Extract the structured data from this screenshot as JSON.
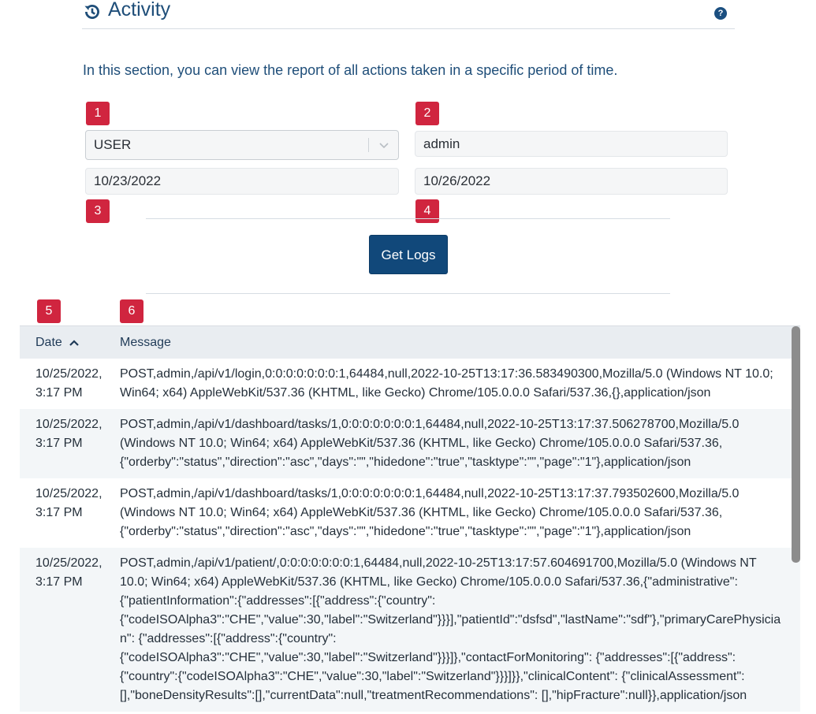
{
  "header": {
    "title": "Activity",
    "help_icon": "?"
  },
  "intro": "In this section, you can view the report of all actions taken in a specific period of time.",
  "badges": [
    "1",
    "2",
    "3",
    "4",
    "5",
    "6"
  ],
  "filters": {
    "type_value": "USER",
    "user_value": "admin",
    "from_date": "10/23/2022",
    "to_date": "10/26/2022"
  },
  "actions": {
    "get_logs": "Get Logs"
  },
  "table": {
    "columns": {
      "date": "Date",
      "message": "Message"
    },
    "rows": [
      {
        "date": "10/25/2022, 3:17 PM",
        "message": "POST,admin,/api/v1/login,0:0:0:0:0:0:0:1,64484,null,2022-10-25T13:17:36.583490300,Mozilla/5.0 (Windows NT 10.0; Win64; x64) AppleWebKit/537.36 (KHTML, like Gecko) Chrome/105.0.0.0 Safari/537.36,{},application/json"
      },
      {
        "date": "10/25/2022, 3:17 PM",
        "message": "POST,admin,/api/v1/dashboard/tasks/1,0:0:0:0:0:0:0:1,64484,null,2022-10-25T13:17:37.506278700,Mozilla/5.0 (Windows NT 10.0; Win64; x64) AppleWebKit/537.36 (KHTML, like Gecko) Chrome/105.0.0.0 Safari/537.36, {\"orderby\":\"status\",\"direction\":\"asc\",\"days\":\"\",\"hidedone\":\"true\",\"tasktype\":\"\",\"page\":\"1\"},application/json"
      },
      {
        "date": "10/25/2022, 3:17 PM",
        "message": "POST,admin,/api/v1/dashboard/tasks/1,0:0:0:0:0:0:0:1,64484,null,2022-10-25T13:17:37.793502600,Mozilla/5.0 (Windows NT 10.0; Win64; x64) AppleWebKit/537.36 (KHTML, like Gecko) Chrome/105.0.0.0 Safari/537.36, {\"orderby\":\"status\",\"direction\":\"asc\",\"days\":\"\",\"hidedone\":\"true\",\"tasktype\":\"\",\"page\":\"1\"},application/json"
      },
      {
        "date": "10/25/2022, 3:17 PM",
        "message": "POST,admin,/api/v1/patient/,0:0:0:0:0:0:0:1,64484,null,2022-10-25T13:17:57.604691700,Mozilla/5.0 (Windows NT 10.0; Win64; x64) AppleWebKit/537.36 (KHTML, like Gecko) Chrome/105.0.0.0 Safari/537.36,{\"administrative\": {\"patientInformation\":{\"addresses\":[{\"address\":{\"country\": {\"codeISOAlpha3\":\"CHE\",\"value\":30,\"label\":\"Switzerland\"}}}],\"patientId\":\"dsfsd\",\"lastName\":\"sdf\"},\"primaryCarePhysician\": {\"addresses\":[{\"address\":{\"country\":{\"codeISOAlpha3\":\"CHE\",\"value\":30,\"label\":\"Switzerland\"}}}]},\"contactForMonitoring\": {\"addresses\":[{\"address\":{\"country\":{\"codeISOAlpha3\":\"CHE\",\"value\":30,\"label\":\"Switzerland\"}}}]}},\"clinicalContent\": {\"clinicalAssessment\":[],\"boneDensityResults\":[],\"currentData\":null,\"treatmentRecommendations\": [],\"hipFracture\":null}},application/json"
      }
    ]
  },
  "colors": {
    "accent": "#11487a",
    "badge": "#d0253f",
    "header_text": "#1f4e79"
  }
}
